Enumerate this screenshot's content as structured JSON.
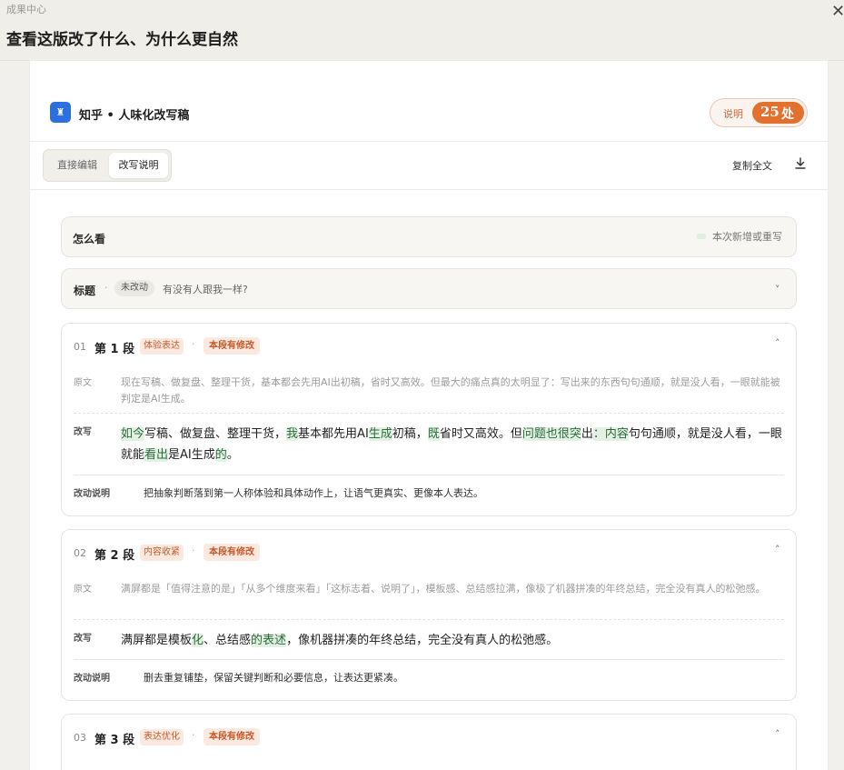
{
  "header": {
    "crumb": "成果中心",
    "title": "查看这版改了什么、为什么更自然",
    "close_glyph": "✕"
  },
  "doc": {
    "logo_glyph": "♜",
    "title": "知乎 • 人味化改写稿",
    "note_label": "说明",
    "note_count": "25",
    "note_unit": "处"
  },
  "toolbar": {
    "mode_direct": "直接编辑",
    "mode_explain": "改写说明",
    "copy_all": "复制全文"
  },
  "howto": {
    "title": "怎么看",
    "legend": "本次新增或重写"
  },
  "title_section": {
    "label": "标题",
    "dot": "·",
    "badge": "未改动",
    "value": "有没有人跟我一样?",
    "chevron": "˅"
  },
  "labels": {
    "original": "原文",
    "rewrite": "改写",
    "reason": "改动说明",
    "dot": "·",
    "chevron_up": "˄"
  },
  "paragraphs": [
    {
      "num": "01",
      "name": "第 1 段",
      "tag": "体验表达",
      "status": "本段有修改",
      "original": "现在写稿、做复盘、整理干货，基本都会先用AI出初稿，省时又高效。但最大的痛点真的太明显了：写出来的东西句句通顺，就是没人看，一眼就能被判定是AI生成。",
      "rewrite": [
        {
          "t": "如今",
          "h": true
        },
        {
          "t": "写稿、做复盘、整理干货，",
          "h": false
        },
        {
          "t": "我",
          "h": true
        },
        {
          "t": "基本都先用AI",
          "h": false
        },
        {
          "t": "生成",
          "h": true
        },
        {
          "t": "初稿，",
          "h": false
        },
        {
          "t": "既",
          "h": true
        },
        {
          "t": "省时又高效。但",
          "h": false
        },
        {
          "t": "问题也很突",
          "h": true
        },
        {
          "t": "出",
          "h": false
        },
        {
          "t": "：内容",
          "h": true
        },
        {
          "t": "句句通顺，就是没人看，一眼就能",
          "h": false
        },
        {
          "t": "看出",
          "h": true
        },
        {
          "t": "是AI生成",
          "h": false
        },
        {
          "t": "的",
          "h": true
        },
        {
          "t": "。",
          "h": false
        }
      ],
      "reason": "把抽象判断落到第一人称体验和具体动作上，让语气更真实、更像本人表达。"
    },
    {
      "num": "02",
      "name": "第 2 段",
      "tag": "内容收紧",
      "status": "本段有修改",
      "original": "满屏都是「值得注意的是」「从多个维度来看」「这标志着、说明了」，模板感、总结感拉满，像极了机器拼凑的年终总结，完全没有真人的松弛感。",
      "rewrite": [
        {
          "t": "满屏都是模板",
          "h": false
        },
        {
          "t": "化",
          "h": true
        },
        {
          "t": "、总结感",
          "h": false
        },
        {
          "t": "的表述",
          "h": true
        },
        {
          "t": "，像机器拼凑的年终总结，完全没有真人的松弛感。",
          "h": false
        }
      ],
      "reason": "删去重复铺垫，保留关键判断和必要信息，让表达更紧凑。"
    },
    {
      "num": "03",
      "name": "第 3 段",
      "tag": "表达优化",
      "status": "本段有修改",
      "original": "",
      "rewrite": [],
      "reason": ""
    }
  ]
}
